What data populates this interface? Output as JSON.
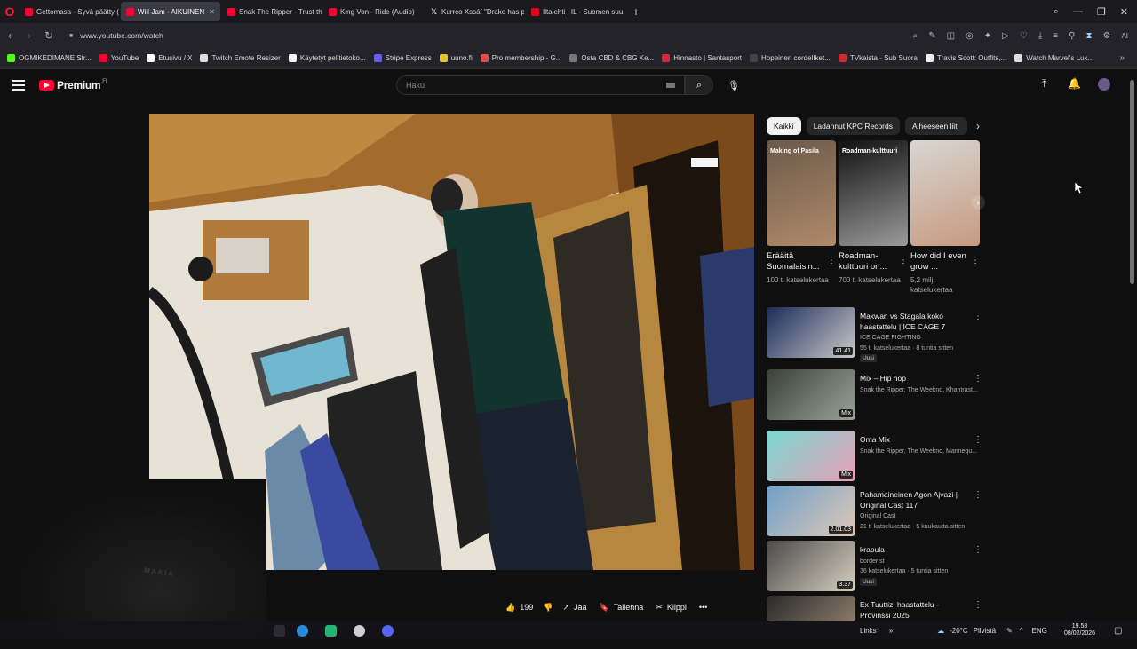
{
  "browser": {
    "tabs": [
      {
        "title": "Gettomasa - Syvä päätty (",
        "icon": "youtube"
      },
      {
        "title": "Will-Jam - AIKUINEN",
        "icon": "youtube",
        "active": true
      },
      {
        "title": "Snak The Ripper - Trust th",
        "icon": "youtube"
      },
      {
        "title": "King Von - Ride (Audio)",
        "icon": "youtube"
      },
      {
        "title": "Kurrco Xssáí \"Drake has p",
        "icon": "x"
      },
      {
        "title": "Iltalehti | IL - Suomen suu",
        "icon": "iltalehti"
      }
    ],
    "url": "www.youtube.com/watch",
    "bookmarks": [
      {
        "label": "OGMIKEDIMANE Str...",
        "color": "#53fc18"
      },
      {
        "label": "YouTube",
        "color": "#ff0033"
      },
      {
        "label": "Etusivu / X",
        "color": "#ffffff"
      },
      {
        "label": "Twitch Emote Resizer",
        "color": "#dddddd"
      },
      {
        "label": "Käytetyt pelitietoko...",
        "color": "#f5f5f5"
      },
      {
        "label": "Stripe Express",
        "color": "#635bff"
      },
      {
        "label": "uuno.fi",
        "color": "#e8c22a"
      },
      {
        "label": "Pro membership - G...",
        "color": "#e34a4a"
      },
      {
        "label": "Osta CBD & CBG Ke...",
        "color": "#777777"
      },
      {
        "label": "Hinnasto | Santasport",
        "color": "#d7263d"
      },
      {
        "label": "Hopeinen cordelIket...",
        "color": "#444444"
      },
      {
        "label": "TVkaista - Sub Suora",
        "color": "#cc2b2b"
      },
      {
        "label": "Travis Scott: Outfits,...",
        "color": "#eeeeee"
      },
      {
        "label": "Watch Marvel's Luk...",
        "color": "#dddddd"
      }
    ]
  },
  "youtube": {
    "logo_text": "Premium",
    "region": "FI",
    "search_placeholder": "Haku",
    "actions": {
      "likes": "199",
      "share": "Jaa",
      "save": "Tallenna",
      "clip": "Klippi"
    },
    "chips": [
      "Kaikki",
      "Ladannut KPC Records",
      "Aiheeseen liit"
    ],
    "shorts": [
      {
        "title": "Erääitä Suomalaisin...",
        "views": "100 t. katselukertaa",
        "overlay": "Making of Pasila",
        "colors": [
          "#6b5a4a",
          "#b08a6a"
        ]
      },
      {
        "title": "Roadman-kulttuuri on...",
        "views": "700 t. katselukertaa",
        "overlay": "Roadman-kulttuuri",
        "colors": [
          "#111111",
          "#9a9a9a"
        ]
      },
      {
        "title": "How did I even grow ...",
        "views": "5,2 milj. katselukertaa",
        "overlay": "",
        "colors": [
          "#d8d6d2",
          "#c79a80"
        ]
      }
    ],
    "recommendations": [
      {
        "title": "Makwan vs Stagala koko haastattelu | ICE CAGE 7",
        "channel": "ICE CAGE FIGHTING",
        "meta": "55 t. katselukertaa · 8 tuntia sitten",
        "badge": "41.41",
        "new": "Uusi",
        "colors": [
          "#1b2c5a",
          "#c9c9c9"
        ]
      },
      {
        "title": "Mix – Hip hop",
        "channel": "Snak the Ripper, The Weeknd, Khantrast...",
        "meta": "",
        "badge": "Mix",
        "new": "",
        "colors": [
          "#3a4038",
          "#9aa39a"
        ]
      },
      {
        "title": "Oma Mix",
        "channel": "Snak the Ripper, The Weeknd, Mannequ...",
        "meta": "",
        "badge": "Mix",
        "new": "",
        "colors": [
          "#7ad7d0",
          "#e8a0b8"
        ]
      },
      {
        "title": "Pahamaineinen Agon Ajvazi | Original Cast 117",
        "channel": "Original Cast",
        "meta": "21 t. katselukertaa · 5 kuukautta sitten",
        "badge": "2.01.03",
        "new": "",
        "colors": [
          "#6fa0c8",
          "#e0c8b8"
        ]
      },
      {
        "title": "krapula",
        "channel": "border st",
        "meta": "36 katselukertaa · 5 tuntia sitten",
        "badge": "3.37",
        "new": "Uusi",
        "colors": [
          "#4a4a4a",
          "#d8d0c0"
        ]
      },
      {
        "title": "Ex Tuuttiz, haastattelu - Provinssi 2025",
        "channel": "",
        "meta": "",
        "badge": "",
        "new": "",
        "colors": [
          "#2a2a2a",
          "#8a7a6a"
        ]
      }
    ]
  },
  "taskbar": {
    "links": "Links",
    "weather": "-20°C",
    "weather_text": "Pilvistä",
    "lang": "ENG",
    "time": "19.58",
    "date": "08/02/2026"
  }
}
